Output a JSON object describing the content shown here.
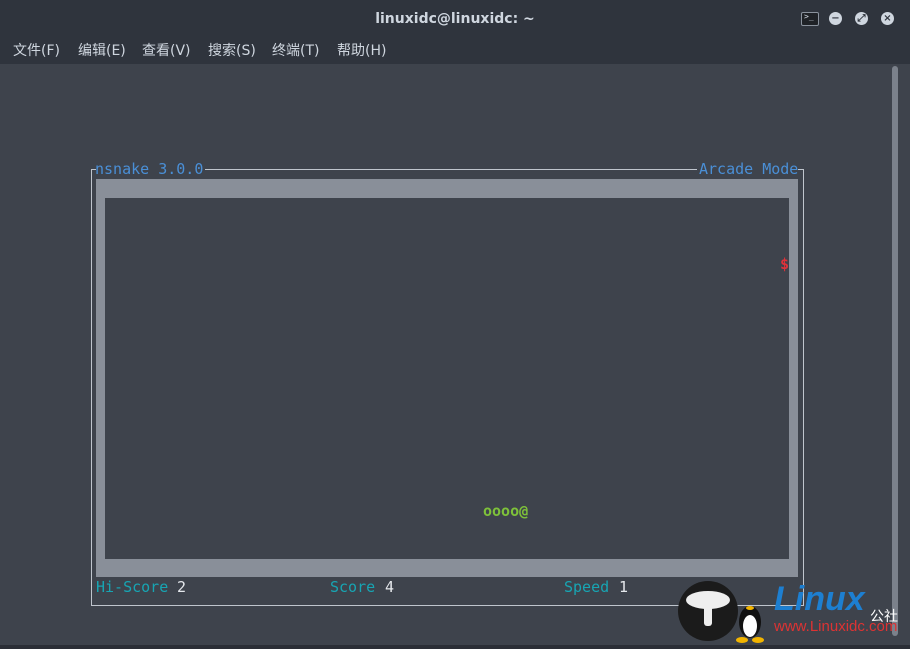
{
  "window": {
    "title": "linuxidc@linuxidc: ~"
  },
  "titlebar": {
    "terminal_icon": "terminal-icon",
    "minimize_icon": "minimize-icon",
    "maximize_icon": "maximize-icon",
    "close_icon": "close-icon"
  },
  "menubar": {
    "items": [
      {
        "label": "文件(F)"
      },
      {
        "label": "编辑(E)"
      },
      {
        "label": "查看(V)"
      },
      {
        "label": "搜索(S)"
      },
      {
        "label": "终端(T)"
      },
      {
        "label": "帮助(H)"
      }
    ]
  },
  "game": {
    "title": "nsnake 3.0.0",
    "mode": "Arcade Mode",
    "fruit": "$",
    "snake": "oooo@",
    "hiscore_label": "Hi-Score",
    "hiscore_value": "2",
    "score_label": "Score",
    "score_value": "4",
    "speed_label": "Speed",
    "speed_value": "1"
  },
  "watermark": {
    "brand": "Linux",
    "site": "www.Linuxidc.com",
    "cn": "公社"
  },
  "colors": {
    "title_blue": "#4a8fd6",
    "label_cyan": "#17a5b3",
    "fruit_red": "#e0323a",
    "snake_green": "#7ec13a",
    "arena_border": "#898f99"
  }
}
